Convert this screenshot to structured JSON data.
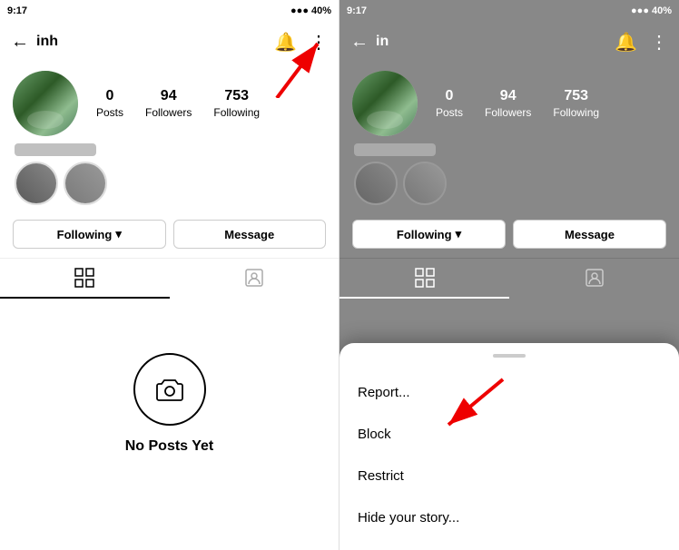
{
  "left": {
    "status": {
      "time": "9:17",
      "right": "40%"
    },
    "nav": {
      "username": "inh",
      "back_label": "←"
    },
    "profile": {
      "posts_count": "0",
      "posts_label": "Posts",
      "followers_count": "94",
      "followers_label": "Followers",
      "following_count": "753",
      "following_label": "Following"
    },
    "buttons": {
      "following": "Following",
      "following_arrow": "▾",
      "message": "Message"
    },
    "tabs": {
      "grid": "⊞",
      "tagged": "👤"
    },
    "no_posts": {
      "text": "No Posts Yet"
    }
  },
  "right": {
    "status": {
      "time": "9:17",
      "right": "40%"
    },
    "nav": {
      "username": "in",
      "back_label": "←"
    },
    "profile": {
      "posts_count": "0",
      "posts_label": "Posts",
      "followers_count": "94",
      "followers_label": "Followers",
      "following_count": "753",
      "following_label": "Following"
    },
    "buttons": {
      "following": "Following",
      "following_arrow": "▾",
      "message": "Message"
    },
    "tabs": {
      "grid": "⊞",
      "tagged": "👤"
    },
    "sheet": {
      "handle": "",
      "report": "Report...",
      "block": "Block",
      "restrict": "Restrict",
      "hide_story": "Hide your story..."
    }
  }
}
